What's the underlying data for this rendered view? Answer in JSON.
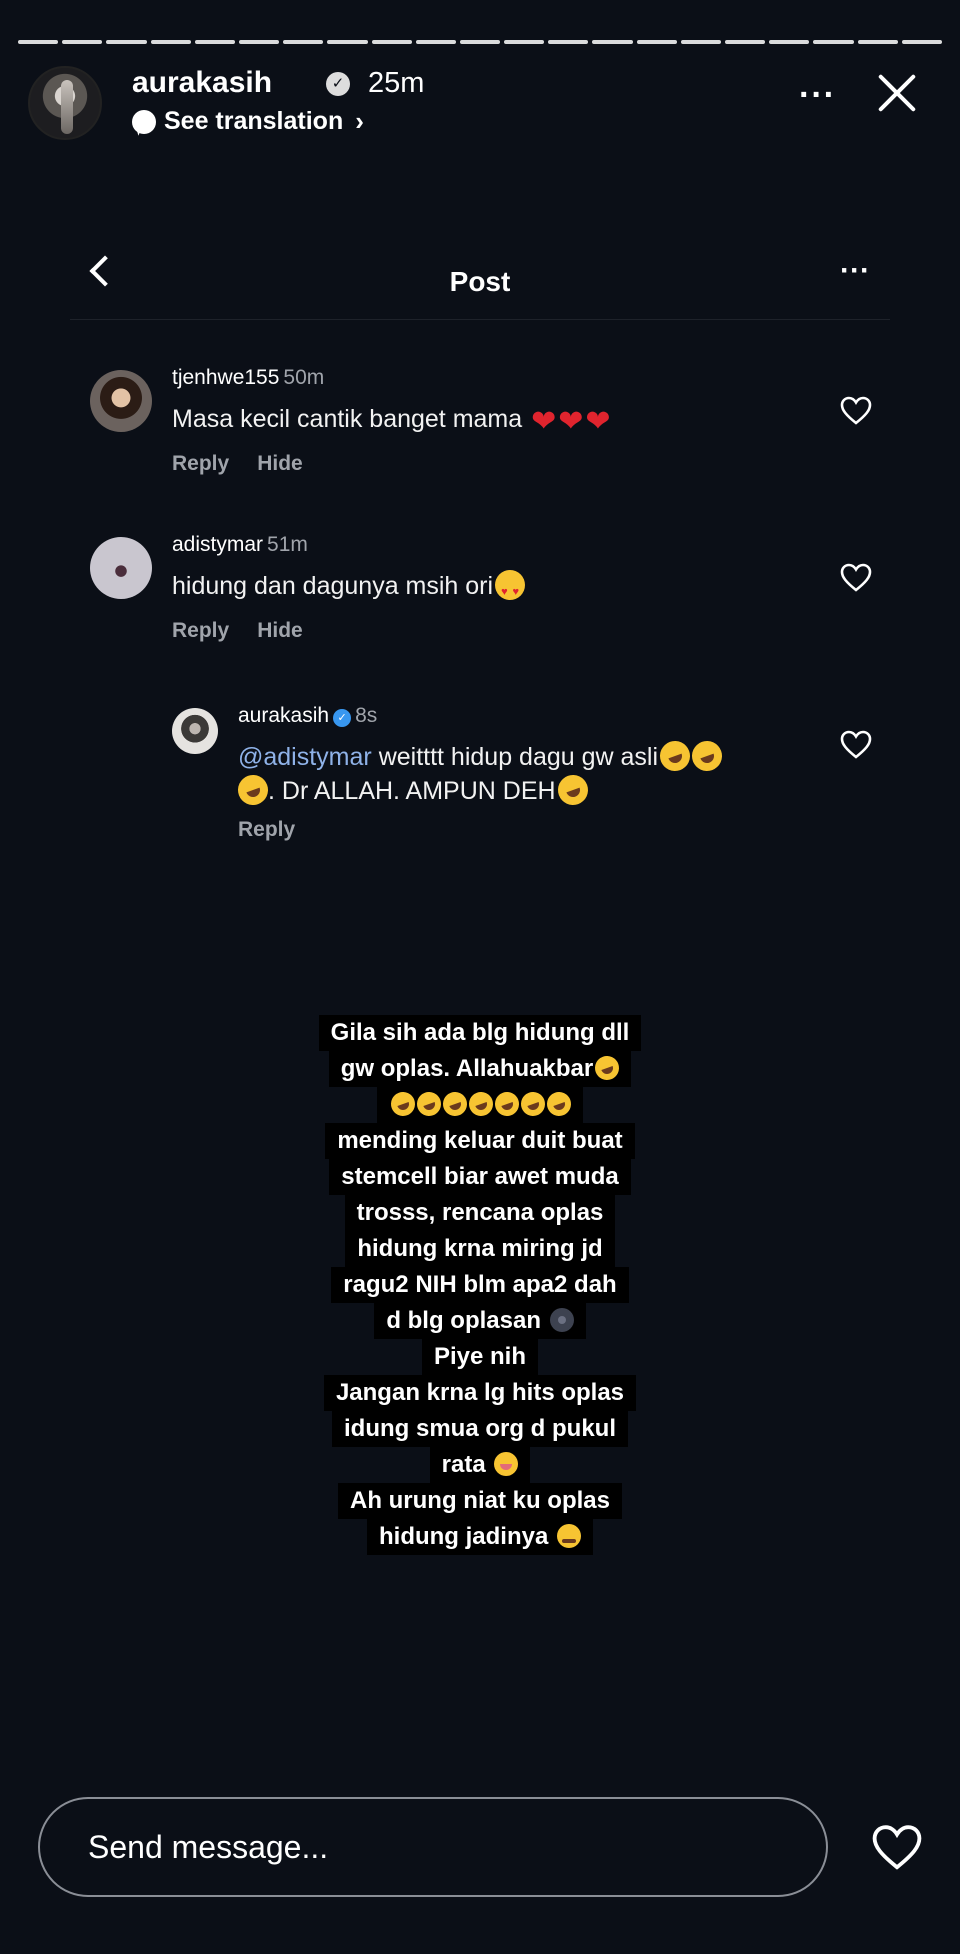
{
  "story": {
    "username": "aurakasih",
    "time": "25m",
    "translation": "See translation",
    "translation_chevron": "›",
    "more": "···",
    "progress_segments": 21
  },
  "post": {
    "title": "Post",
    "more": "···"
  },
  "comments": [
    {
      "username": "tjenhwe155",
      "time": "50m",
      "text": "Masa kecil cantik banget mama",
      "emoji": [
        "red-heart",
        "red-heart",
        "red-heart"
      ],
      "reply": "Reply",
      "hide": "Hide"
    },
    {
      "username": "adistymar",
      "time": "51m",
      "text": "hidung dan dagunya msih ori",
      "emoji": [
        "heart-eyes"
      ],
      "reply": "Reply",
      "hide": "Hide"
    },
    {
      "username": "aurakasih",
      "time": "8s",
      "mention": "@adistymar",
      "text_line1": " weitttt hidup dagu gw asli",
      "text_line2": ". Dr ALLAH. AMPUN DEH",
      "reply": "Reply"
    }
  ],
  "caption": {
    "lines": [
      "Gila sih ada blg hidung dll",
      "gw oplas. Allahuakbar",
      "",
      "mending keluar duit buat",
      "stemcell biar awet muda",
      "trosss, rencana oplas",
      "hidung krna miring  jd",
      "ragu2 NIH blm apa2 dah",
      "d blg oplasan",
      "Piye nih",
      "Jangan krna lg hits oplas",
      "idung smua org d pukul",
      "rata",
      "Ah urung niat ku oplas",
      "hidung jadinya"
    ]
  },
  "footer": {
    "placeholder": "Send message..."
  },
  "colors": {
    "background": "#0b0f17",
    "mention": "#8fb2e8",
    "verified": "#3897f0",
    "meta": "#a0a4ab"
  }
}
